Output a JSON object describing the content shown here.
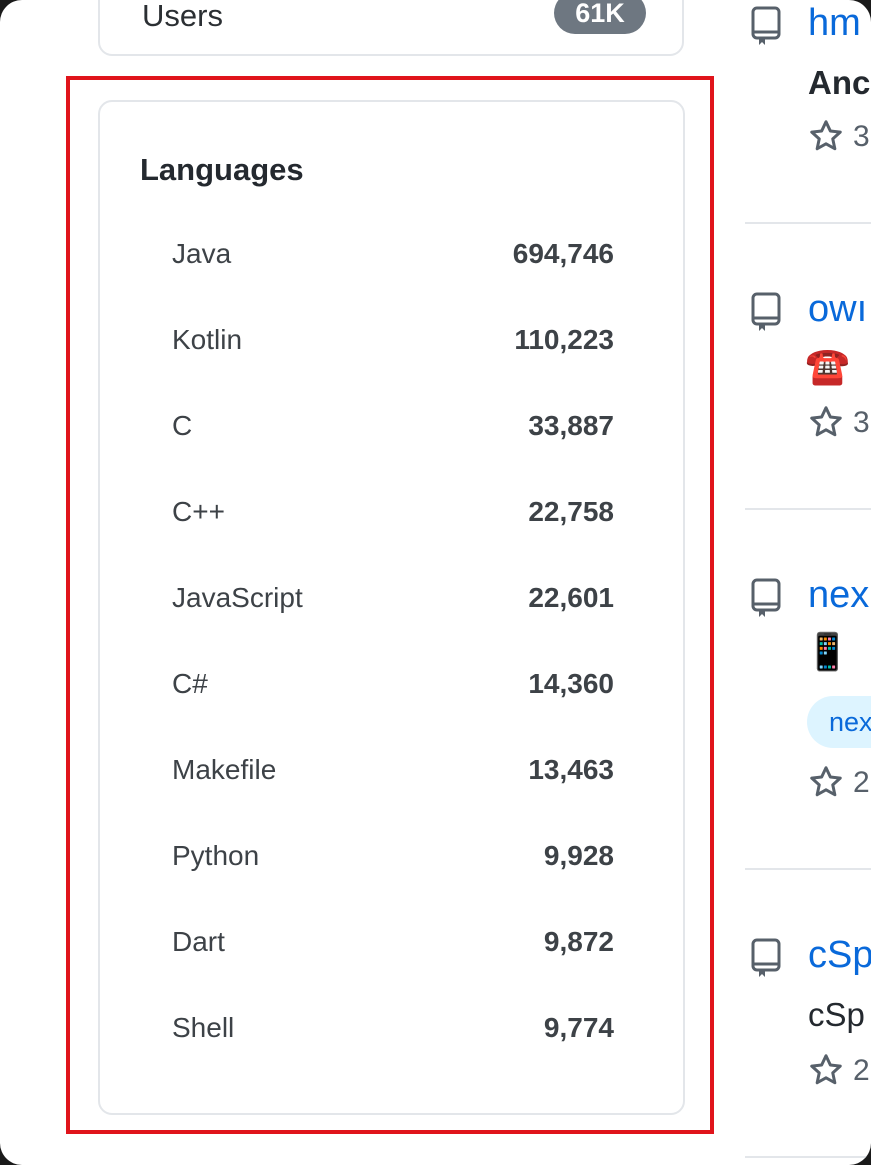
{
  "users_card": {
    "label": "Users",
    "badge": "61K"
  },
  "languages": {
    "title": "Languages",
    "items": [
      {
        "name": "Java",
        "count": "694,746"
      },
      {
        "name": "Kotlin",
        "count": "110,223"
      },
      {
        "name": "C",
        "count": "33,887"
      },
      {
        "name": "C++",
        "count": "22,758"
      },
      {
        "name": "JavaScript",
        "count": "22,601"
      },
      {
        "name": "C#",
        "count": "14,360"
      },
      {
        "name": "Makefile",
        "count": "13,463"
      },
      {
        "name": "Python",
        "count": "9,928"
      },
      {
        "name": "Dart",
        "count": "9,872"
      },
      {
        "name": "Shell",
        "count": "9,774"
      }
    ]
  },
  "repos": [
    {
      "name": "hm",
      "desc": "Anc",
      "stars": "3",
      "icon": "repo-icon"
    },
    {
      "name": "owı",
      "emoji": "☎️",
      "stars": "3",
      "icon": "repo-icon"
    },
    {
      "name": "nex",
      "emoji": "📱",
      "topic": "nex",
      "stars": "2",
      "icon": "repo-icon"
    },
    {
      "name": "cSp",
      "desc": "cSp",
      "stars": "2",
      "icon": "repo-icon"
    }
  ],
  "colors": {
    "link": "#0969da",
    "highlight": "#e0141b",
    "badge": "#6e7781"
  }
}
